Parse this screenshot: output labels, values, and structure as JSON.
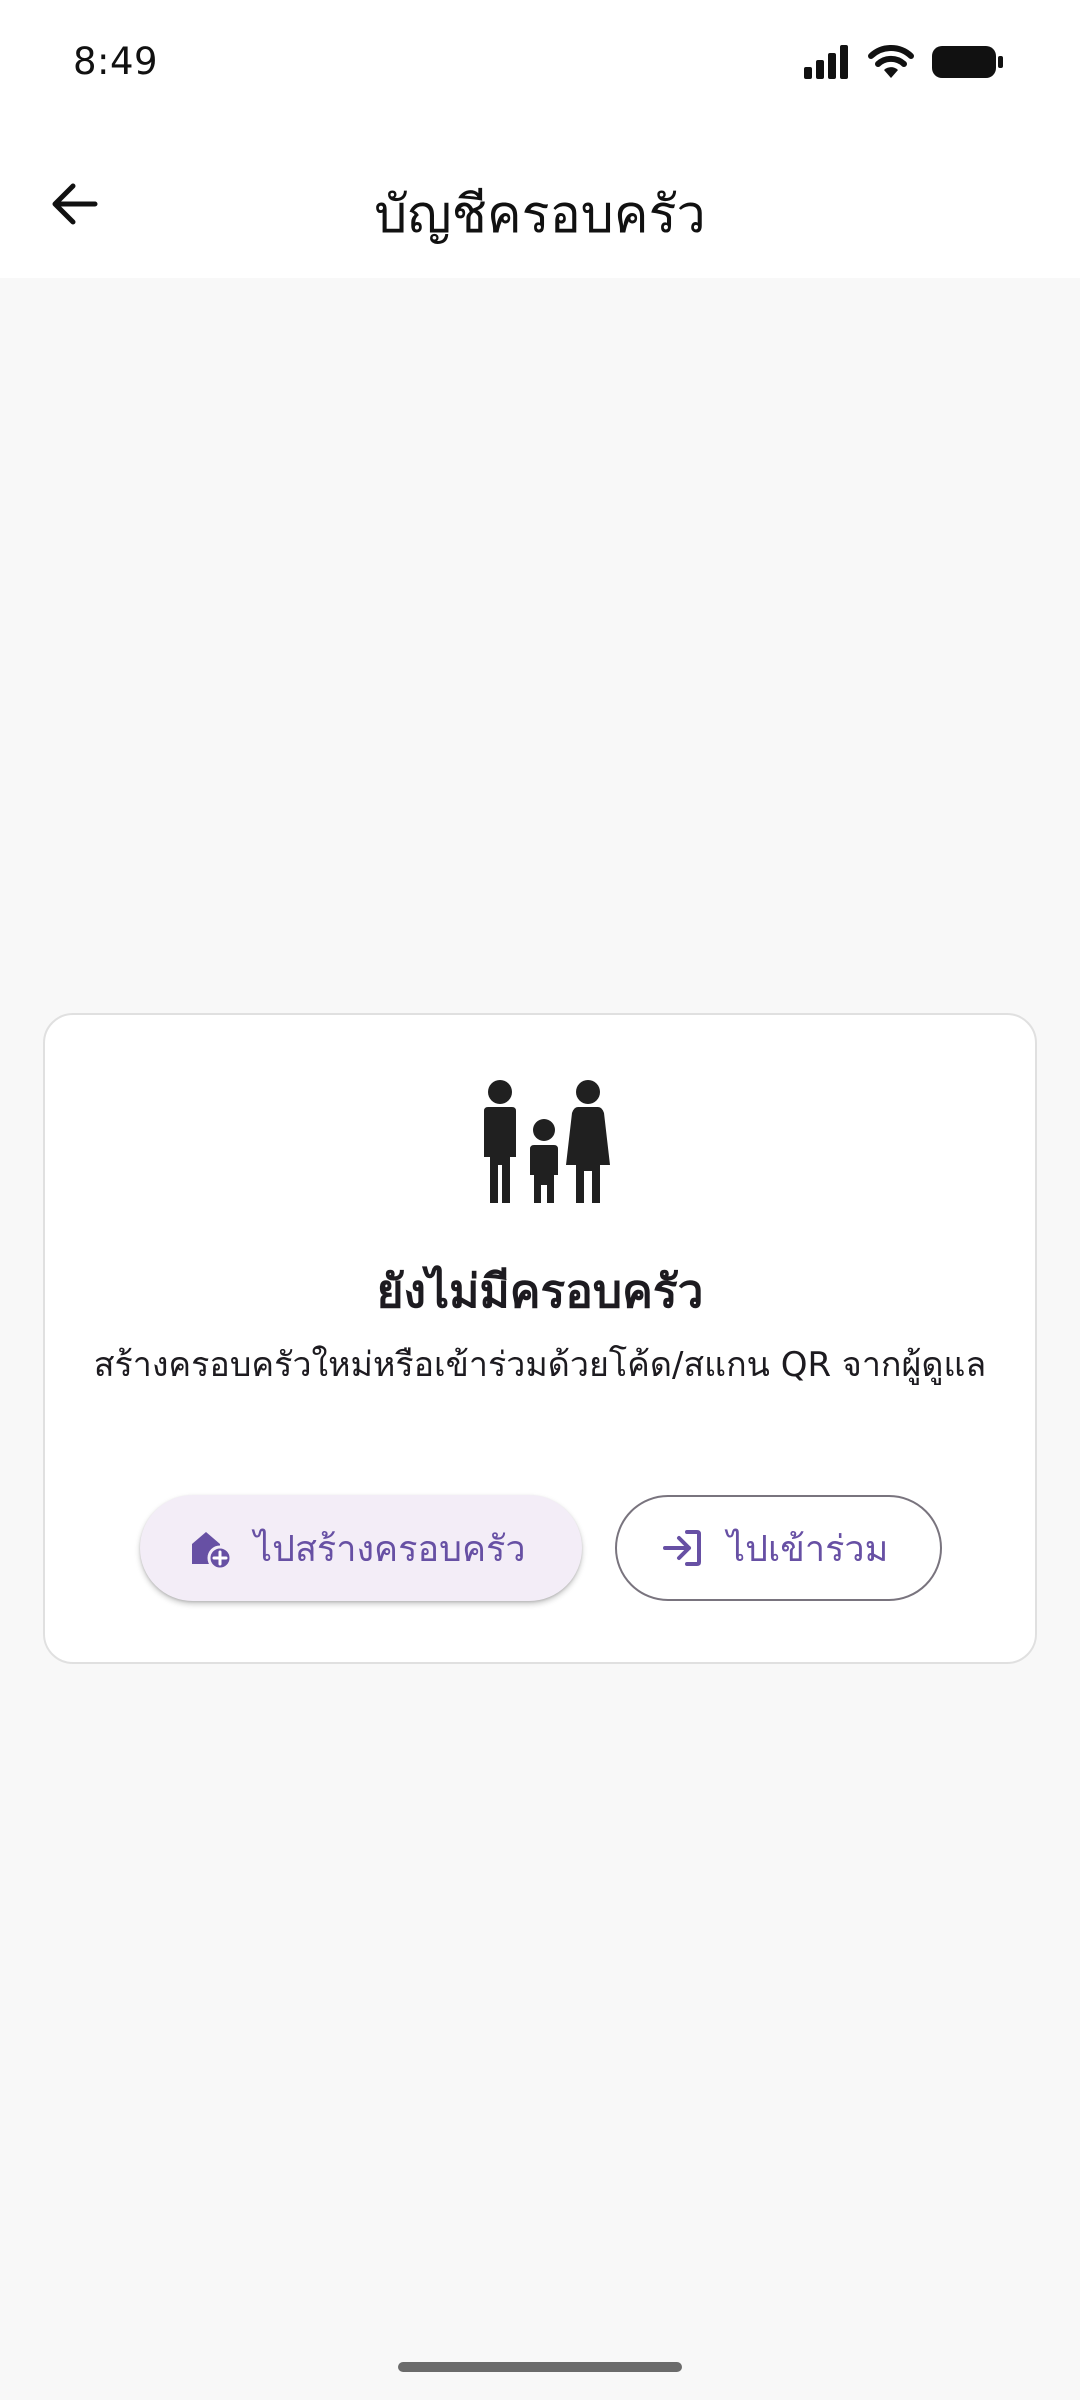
{
  "status_bar": {
    "time": "8:49",
    "icons": [
      "signal-icon",
      "wifi-icon",
      "battery-icon"
    ]
  },
  "app_bar": {
    "back_icon": "arrow-back-icon",
    "title": "บัญชีครอบครัว"
  },
  "empty_state": {
    "icon": "family-icon",
    "title": "ยังไม่มีครอบครัว",
    "description": "สร้างครอบครัวใหม่หรือเข้าร่วมด้วยโค้ด/สแกน QR จากผู้ดูแล",
    "create_button": {
      "icon": "add-home-icon",
      "label": "ไปสร้างครอบครัว"
    },
    "join_button": {
      "icon": "login-icon",
      "label": "ไปเข้าร่วม"
    }
  },
  "colors": {
    "accent": "#6750a4",
    "tonal_button_bg": "#f3edf7",
    "background": "#f8f8f8",
    "surface": "#ffffff"
  }
}
